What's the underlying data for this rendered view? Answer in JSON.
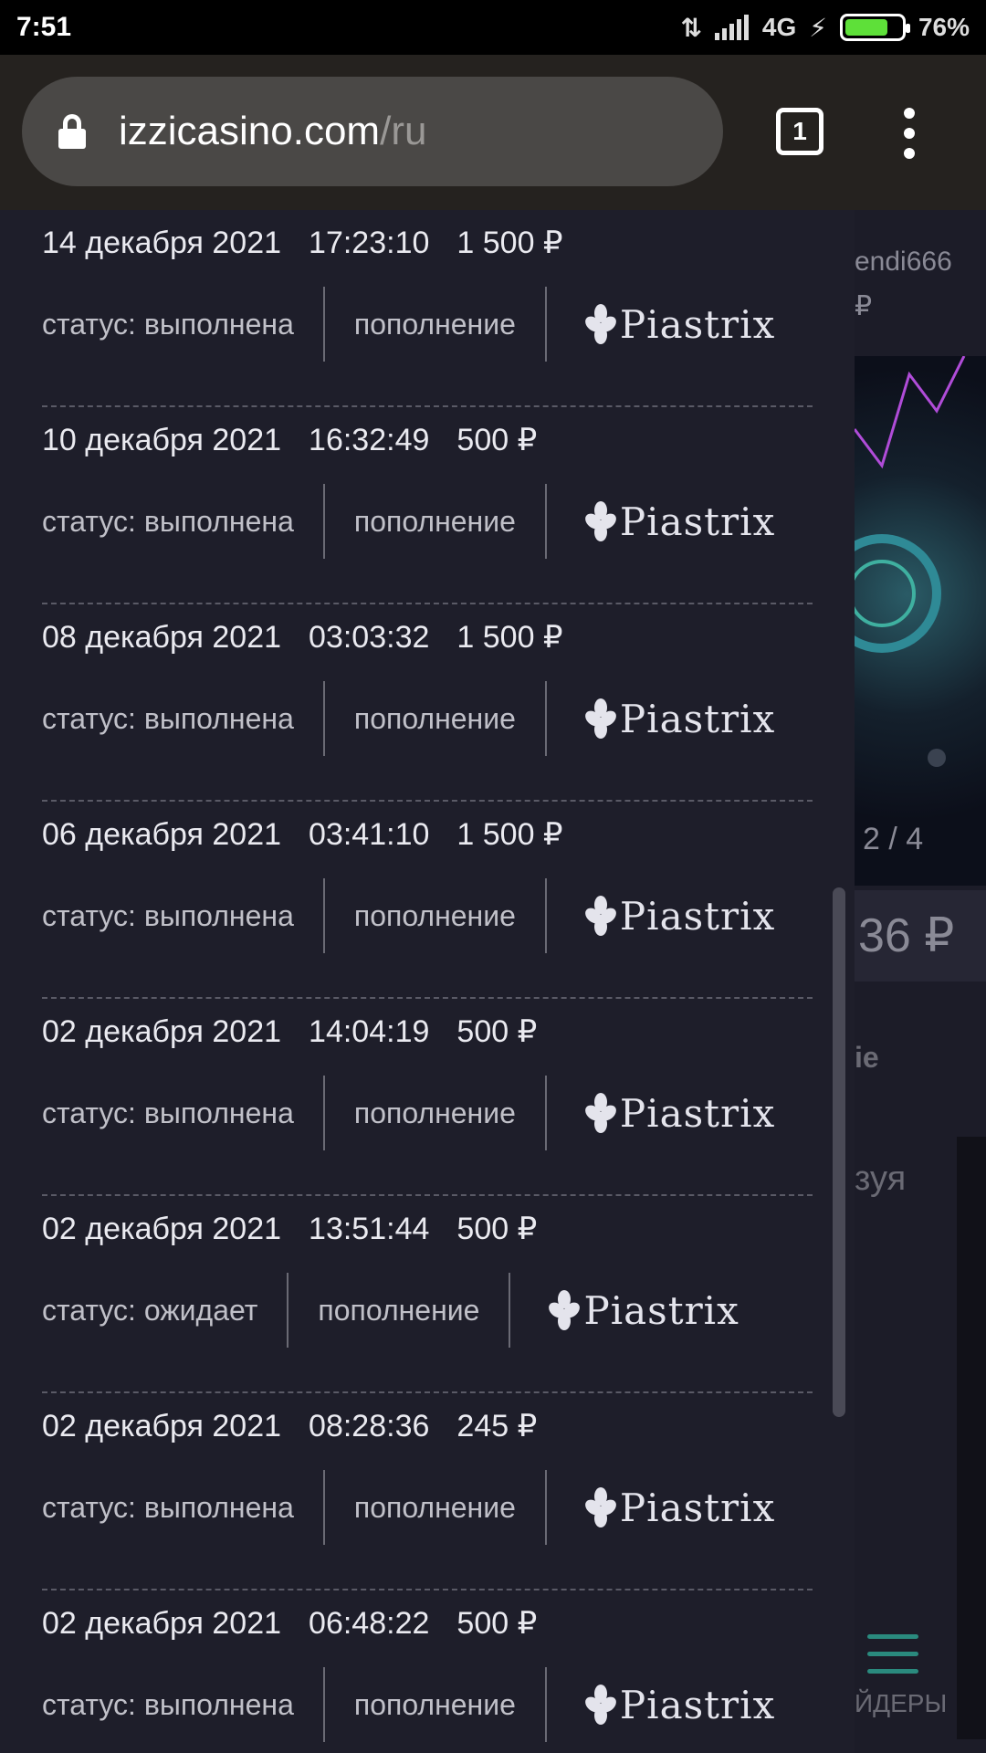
{
  "status_bar": {
    "time": "7:51",
    "network": "4G",
    "battery_percent": "76%"
  },
  "browser": {
    "url_host": "izzicasino.com",
    "url_path": "/ru",
    "tab_count": "1"
  },
  "background_page": {
    "username": "endi666",
    "currency_fragment": "₽",
    "slider_counter": "2 / 4",
    "balance_fragment": "36 ₽",
    "text_fragment_1": "ie",
    "text_fragment_2": "зуя",
    "nav_label_fragment": "ЙДЕРЫ"
  },
  "transactions": [
    {
      "date": "14 декабря 2021",
      "time": "17:23:10",
      "amount": "1 500 ₽",
      "status": "статус: выполнена",
      "type": "пополнение",
      "provider": "Piastrix"
    },
    {
      "date": "10 декабря 2021",
      "time": "16:32:49",
      "amount": "500 ₽",
      "status": "статус: выполнена",
      "type": "пополнение",
      "provider": "Piastrix"
    },
    {
      "date": "08 декабря 2021",
      "time": "03:03:32",
      "amount": "1 500 ₽",
      "status": "статус: выполнена",
      "type": "пополнение",
      "provider": "Piastrix"
    },
    {
      "date": "06 декабря 2021",
      "time": "03:41:10",
      "amount": "1 500 ₽",
      "status": "статус: выполнена",
      "type": "пополнение",
      "provider": "Piastrix"
    },
    {
      "date": "02 декабря 2021",
      "time": "14:04:19",
      "amount": "500 ₽",
      "status": "статус: выполнена",
      "type": "пополнение",
      "provider": "Piastrix"
    },
    {
      "date": "02 декабря 2021",
      "time": "13:51:44",
      "amount": "500 ₽",
      "status": "статус: ожидает",
      "type": "пополнение",
      "provider": "Piastrix"
    },
    {
      "date": "02 декабря 2021",
      "time": "08:28:36",
      "amount": "245 ₽",
      "status": "статус: выполнена",
      "type": "пополнение",
      "provider": "Piastrix"
    },
    {
      "date": "02 декабря 2021",
      "time": "06:48:22",
      "amount": "500 ₽",
      "status": "статус: выполнена",
      "type": "пополнение",
      "provider": "Piastrix"
    }
  ]
}
